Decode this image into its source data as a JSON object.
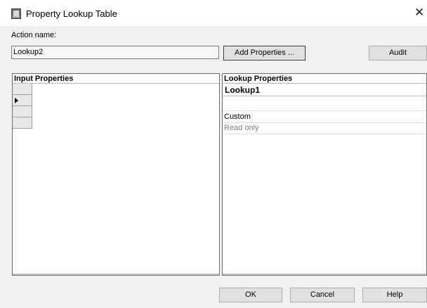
{
  "window": {
    "title": "Property Lookup Table",
    "close_glyph": "✕"
  },
  "action": {
    "label": "Action name:",
    "value": "Lookup2"
  },
  "buttons": {
    "add_properties": "Add Properties ...",
    "audit": "Audit",
    "ok": "OK",
    "cancel": "Cancel",
    "help": "Help"
  },
  "input_panel": {
    "header": "Input Properties",
    "row_count": 4,
    "selected_row": 2
  },
  "lookup_panel": {
    "header": "Lookup Properties",
    "title": "Lookup1",
    "rows": [
      "",
      "Custom",
      "Read only"
    ]
  },
  "icons": {
    "app": "autocad-app-icon",
    "close": "close-icon",
    "row_pointer": "row-pointer-icon"
  }
}
